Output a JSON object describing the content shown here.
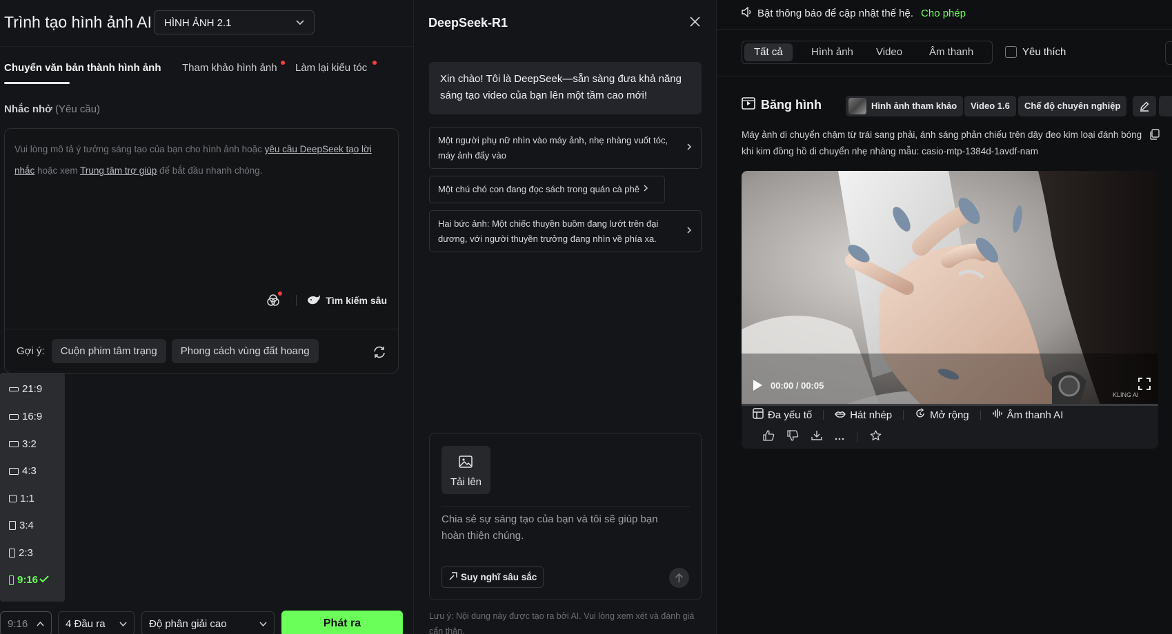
{
  "left": {
    "app_title": "Trình tạo hình ảnh AI",
    "model": "HÌNH ẢNH 2.1",
    "tabs": [
      {
        "label": "Chuyển văn bản thành hình ảnh",
        "active": true
      },
      {
        "label": "Tham khảo hình ảnh",
        "dot": true
      },
      {
        "label": "Làm lại kiểu tóc",
        "dot": true
      }
    ],
    "prompt_label": "Nhắc nhở",
    "prompt_required": "(Yêu cầu)",
    "prompt_placeholder": {
      "p1": "Vui lòng mô tả ý tưởng sáng tạo của bạn cho hình ảnh hoặc ",
      "link1": "yêu cầu DeepSeek tạo lời nhắc",
      "p2": " hoặc xem ",
      "link2": "Trung tâm trợ giúp",
      "p3": " để bắt đầu nhanh chóng."
    },
    "deep_search": "Tìm kiếm sâu",
    "suggest_label": "Gợi ý:",
    "suggestions": [
      "Cuộn phim tâm trạng",
      "Phong cách vùng đất hoang"
    ],
    "ratios": [
      {
        "label": "21:9"
      },
      {
        "label": "16:9"
      },
      {
        "label": "3:2"
      },
      {
        "label": "4:3"
      },
      {
        "label": "1:1"
      },
      {
        "label": "3:4"
      },
      {
        "label": "2:3"
      },
      {
        "label": "9:16",
        "selected": true
      }
    ],
    "bottom": {
      "ratio_value": "9:16",
      "outputs": "4 Đầu ra",
      "resolution": "Độ phân giải cao",
      "generate": "Phát ra"
    }
  },
  "mid": {
    "title": "DeepSeek-R1",
    "greeting": "Xin chào! Tôi là DeepSeek—sẵn sàng đưa khả năng sáng tạo video của bạn lên một tầm cao mới!",
    "suggestions": [
      "Một người phụ nữ nhìn vào máy ảnh, nhẹ nhàng vuốt tóc, máy ảnh đẩy vào",
      "Một chú chó con đang đọc sách trong quán cà phê",
      "Hai bức ảnh: Một chiếc thuyền buồm đang lướt trên đại dương, với người thuyền trưởng đang nhìn về phía xa."
    ],
    "upload": "Tải lên",
    "compose_placeholder": "Chia sẻ sự sáng tạo của bạn và tôi sẽ giúp bạn hoàn thiện chúng.",
    "think": "Suy nghĩ sâu sắc",
    "disclaimer": "Lưu ý: Nội dung này được tạo ra bởi AI. Vui lòng xem xét và đánh giá cẩn thận."
  },
  "right": {
    "notice": "Bật thông báo để cập nhật thế hệ.",
    "allow": "Cho phép",
    "filters": [
      {
        "label": "Tất cả",
        "active": true
      },
      {
        "label": "Hình ảnh"
      },
      {
        "label": "Video"
      },
      {
        "label": "Âm thanh"
      }
    ],
    "favorites": "Yêu thích",
    "section_title": "Băng hình",
    "tags": [
      "Hình ảnh tham khảo",
      "Video 1.6",
      "Chế độ chuyên nghiệp"
    ],
    "description": "Máy ảnh di chuyển chậm từ trái sang phải, ánh sáng phản chiếu trên dây đeo kim loại đánh bóng khi kim đồng hồ di chuyển nhẹ nhàng mẫu: casio-mtp-1384d-1avdf-nam",
    "time": "00:00 / 00:05",
    "watermark": "KLING AI",
    "actions": [
      "Đa yếu tố",
      "Hát nhép",
      "Mở rộng",
      "Âm thanh AI"
    ]
  },
  "colors": {
    "accent": "#6bff5a",
    "dot": "#ff3b3b",
    "panel_bg": "#141518",
    "page_bg": "#0d0e10"
  }
}
